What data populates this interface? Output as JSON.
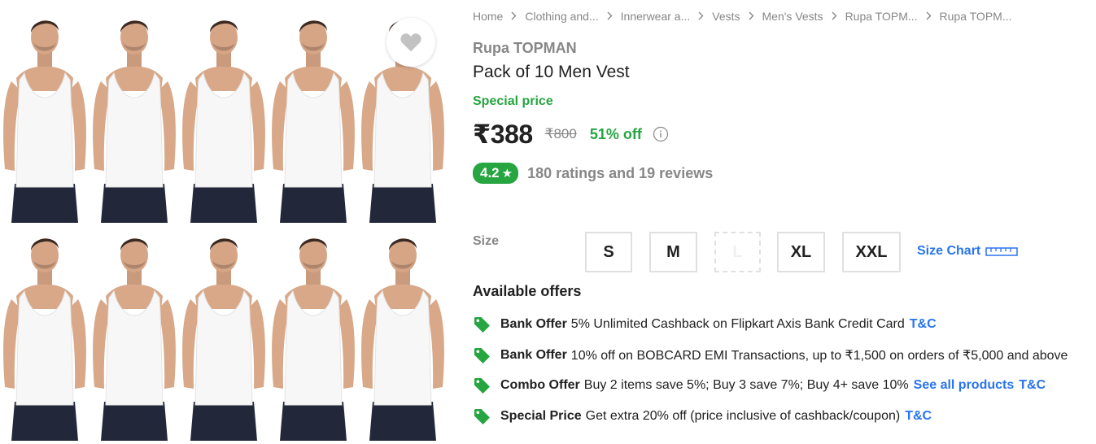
{
  "breadcrumb": [
    "Home",
    "Clothing and...",
    "Innerwear a...",
    "Vests",
    "Men's Vests",
    "Rupa TOPM...",
    "Rupa TOPM..."
  ],
  "product": {
    "brand": "Rupa TOPMAN",
    "title": "Pack of 10 Men Vest",
    "special_label": "Special price",
    "price": "₹388",
    "mrp": "₹800",
    "discount": "51% off"
  },
  "rating": {
    "value": "4.2",
    "star": "★",
    "summary": "180 ratings and 19 reviews"
  },
  "size": {
    "label": "Size",
    "options": [
      {
        "label": "S",
        "available": true
      },
      {
        "label": "M",
        "available": true
      },
      {
        "label": "L",
        "available": false
      },
      {
        "label": "XL",
        "available": true
      },
      {
        "label": "XXL",
        "available": true
      }
    ],
    "chart_label": "Size Chart"
  },
  "offers": {
    "title": "Available offers",
    "items": [
      {
        "type": "Bank Offer",
        "text": "5% Unlimited Cashback on Flipkart Axis Bank Credit Card",
        "links": [
          "T&C"
        ]
      },
      {
        "type": "Bank Offer",
        "text": "10% off on BOBCARD EMI Transactions, up to ₹1,500 on orders of ₹5,000 and above",
        "links": []
      },
      {
        "type": "Combo Offer",
        "text": "Buy 2 items save 5%; Buy 3 save 7%; Buy 4+ save 10%",
        "links": [
          "See all products",
          "T&C"
        ]
      },
      {
        "type": "Special Price",
        "text": "Get extra 20% off (price inclusive of cashback/coupon)",
        "links": [
          "T&C"
        ]
      }
    ]
  },
  "icons": {
    "wishlist": "heart-icon",
    "info": "info-icon",
    "size_chart": "ruler-icon",
    "offer": "tag-icon"
  },
  "colors": {
    "green": "#26a541",
    "blue": "#2874f0",
    "grey": "#878787"
  }
}
